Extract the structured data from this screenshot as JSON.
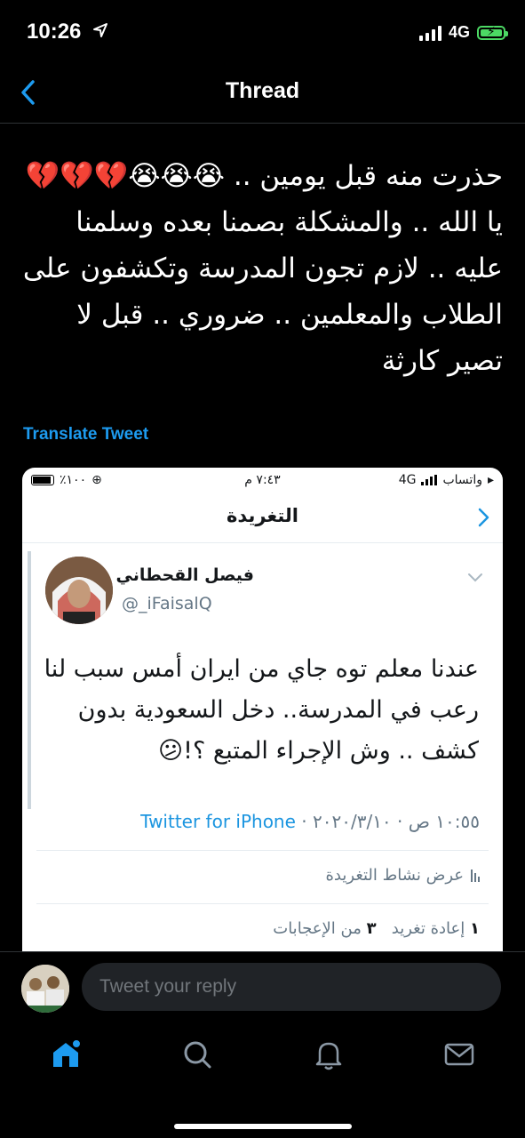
{
  "status_bar": {
    "time": "10:26",
    "network": "4G"
  },
  "nav": {
    "title": "Thread"
  },
  "tweet": {
    "text": "حذرت منه  قبل يومين .. 😭😭😭💔💔💔 يا الله .. والمشكلة بصمنا بعده وسلمنا عليه .. لازم تجون المدرسة وتكشفون على الطلاب والمعلمين .. ضروري .. قبل لا تصير كارثة",
    "translate_label": "Translate Tweet"
  },
  "embedded": {
    "status": {
      "carrier": "واتساب",
      "network": "4G",
      "time": "٧:٤٣ م",
      "battery": "٪١٠٠"
    },
    "header_title": "التغريدة",
    "author_name": "فيصل القحطاني",
    "author_handle": "@_iFaisalQ",
    "body": "عندنا معلم توه جاي من ايران أمس سبب لنا رعب في المدرسة.. دخل السعودية بدون كشف .. وش الإجراء المتبع ؟!😕",
    "meta_time": "١٠:٥٥ ص · ٢٠٢٠/٣/١٠ · ",
    "meta_source": "Twitter for iPhone",
    "activity_label": "عرض نشاط التغريدة",
    "retweets_count": "١",
    "retweets_label": "إعادة تغريد",
    "likes_count": "٣",
    "likes_label": "من الإعجابات"
  },
  "reply": {
    "placeholder": "Tweet your reply"
  },
  "colors": {
    "accent": "#1d9bf0",
    "background": "#000000",
    "battery": "#4cd964"
  },
  "icons": {
    "tabs": [
      "home-icon",
      "search-icon",
      "notifications-bell-icon",
      "messages-envelope-icon"
    ]
  }
}
